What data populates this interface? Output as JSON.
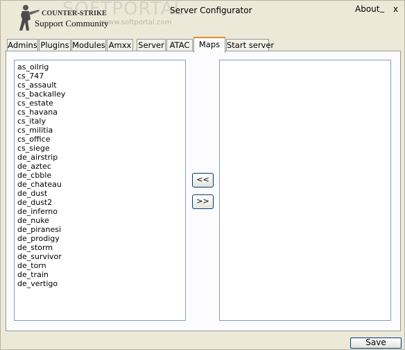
{
  "header": {
    "logo_line1": "COUNTER-STRIKE",
    "logo_line2": "Support Community",
    "watermark": "SOFTPORTAL",
    "watermark_url": "www.softportal.com",
    "app_title": "Server Configurator",
    "about_label": "About",
    "minimize_label": "_",
    "close_label": "x"
  },
  "tabs": [
    {
      "label": "Admins"
    },
    {
      "label": "Plugins"
    },
    {
      "label": "Modules"
    },
    {
      "label": "Amxx"
    },
    {
      "label": "Server"
    },
    {
      "label": "ATAC"
    },
    {
      "label": "Maps"
    },
    {
      "label": "Start server"
    }
  ],
  "active_tab": "Maps",
  "colors": {
    "background": "#ECE9D8",
    "active_tab_accent": "#E68B2C",
    "listbox_border": "#7F9DB9"
  },
  "maps": {
    "available": [
      "as_oilrig",
      "cs_747",
      "cs_assault",
      "cs_backalley",
      "cs_estate",
      "cs_havana",
      "cs_italy",
      "cs_militia",
      "cs_office",
      "cs_siege",
      "de_airstrip",
      "de_aztec",
      "de_cbble",
      "de_chateau",
      "de_dust",
      "de_dust2",
      "de_inferno",
      "de_nuke",
      "de_piranesi",
      "de_prodigy",
      "de_storm",
      "de_survivor",
      "de_torn",
      "de_train",
      "de_vertigo"
    ],
    "selected": [],
    "move_left_label": "<<",
    "move_right_label": ">>"
  },
  "footer": {
    "save_label": "Save"
  }
}
